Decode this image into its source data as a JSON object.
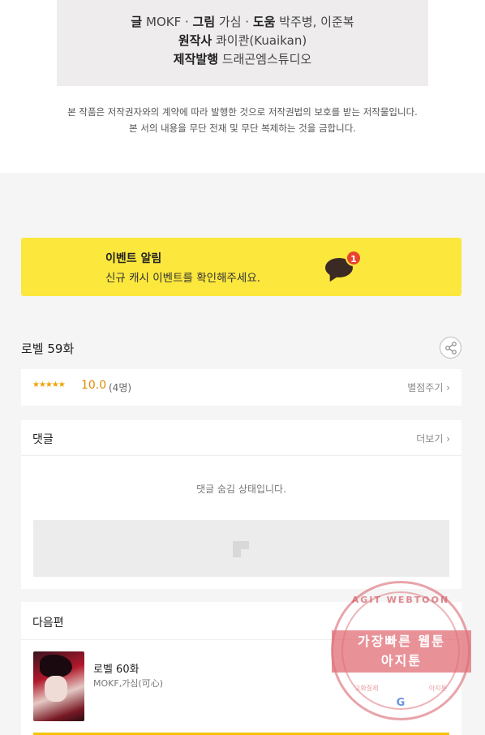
{
  "credits": {
    "writer_label": "글",
    "writer": "MOKF",
    "art_label": "그림",
    "art": "가심",
    "assist_label": "도움",
    "assist": "박주병, 이준복",
    "original_label": "원작사",
    "original": "콰이콴(Kuaikan)",
    "publisher_label": "제작발행",
    "publisher": "드래곤엠스튜디오"
  },
  "notice": {
    "line1": "본 작품은 저작권자와의 계약에 따라 발행한 것으로 저작권법의 보호를 받는 저작물입니다.",
    "line2": "본 서의 내용을 무단 전재 및 무단 복제하는 것을 금합니다."
  },
  "event": {
    "title": "이벤트 알림",
    "subtitle": "신규 캐시 이벤트를 확인해주세요.",
    "badge": "1",
    "color": "#fce73d"
  },
  "episode": {
    "title": "로벨 59화"
  },
  "rating": {
    "stars": "★★★★★",
    "score": "10.0",
    "count": "(4명)",
    "action": "별점주기 ›"
  },
  "comments": {
    "title": "댓글",
    "more": "더보기 ›",
    "hidden": "댓글 숨김 상태입니다."
  },
  "next": {
    "title": "다음편",
    "episode": "로벨 60화",
    "authors": "MOKF,가심(可心)"
  },
  "watermark": {
    "arc": "AGIT WEBTOON",
    "line1": "가장빠른 웹툰",
    "line2": "아지툰",
    "g": "G",
    "left": "고화질제",
    "right": "아지툰"
  }
}
